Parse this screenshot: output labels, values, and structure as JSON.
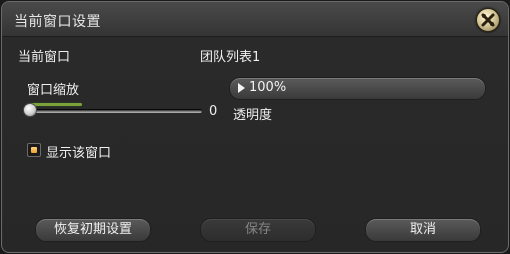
{
  "window": {
    "title": "当前窗口设置"
  },
  "settings": {
    "current_window_label": "当前窗口",
    "current_window_value": "团队列表1",
    "window_zoom_label": "窗口缩放",
    "zoom_value": "100%",
    "opacity_value": "0",
    "opacity_label": "透明度",
    "show_window_label": "显示该窗口",
    "show_window_checked": true
  },
  "buttons": {
    "reset": "恢复初期设置",
    "save": "保存",
    "cancel": "取消"
  },
  "colors": {
    "accent_green": "#7aa13a",
    "checkbox_orange": "#f0a22f"
  },
  "icons": {
    "close": "close-crossed-tools-icon",
    "dropdown": "play-triangle-icon"
  }
}
